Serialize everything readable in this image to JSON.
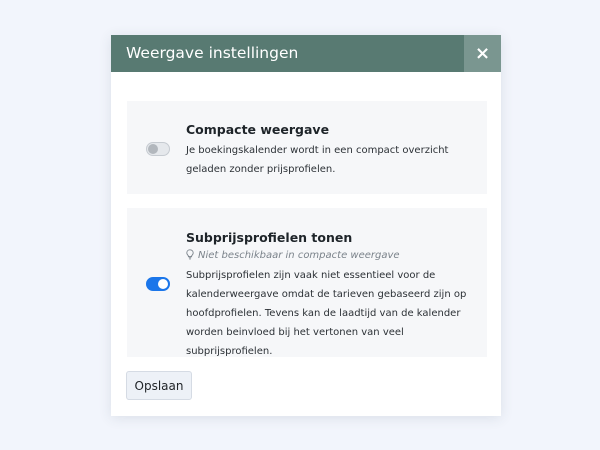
{
  "modal": {
    "title": "Weergave instellingen",
    "close_label": "×"
  },
  "options": [
    {
      "title": "Compacte weergave",
      "description": "Je boekingskalender wordt in een compact overzicht geladen zonder prijsprofielen.",
      "enabled": false
    },
    {
      "title": "Subprijsprofielen tonen",
      "hint": "Niet beschikbaar in compacte weergave",
      "hint_icon": "lightbulb-icon",
      "description": "Subprijsprofielen zijn vaak niet essentieel voor de kalenderweergave omdat de tarieven gebaseerd zijn op hoofdprofielen. Tevens kan de laadtijd van de kalender worden beinvloed bij het vertonen van veel subprijsprofielen.",
      "enabled": true
    }
  ],
  "footer": {
    "save_label": "Opslaan"
  },
  "colors": {
    "header": "#587a72",
    "toggle_on": "#1b76ea",
    "page_background": "#f2f5fc"
  }
}
